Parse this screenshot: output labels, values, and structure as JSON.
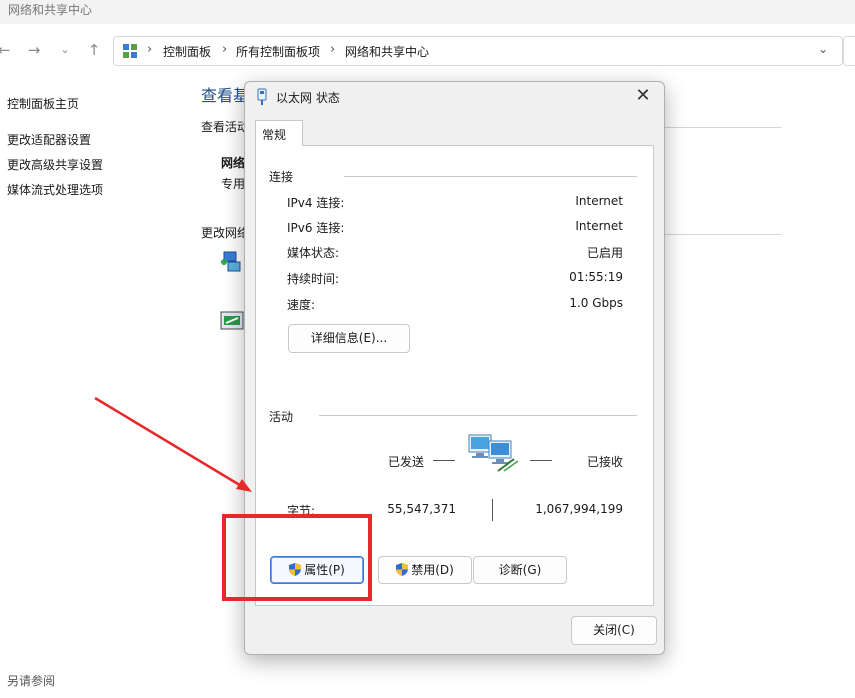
{
  "window": {
    "title": "网络和共享中心"
  },
  "address_bar": {
    "crumbs": [
      "控制面板",
      "所有控制面板项",
      "网络和共享中心"
    ],
    "icon": "control-panel-icon"
  },
  "sidebar": {
    "home": "控制面板主页",
    "items": [
      "更改适配器设置",
      "更改高级共享设置",
      "媒体流式处理选项"
    ],
    "see_also": "另请参阅"
  },
  "main": {
    "title": "查看基",
    "active_networks_label": "查看活动",
    "network_name": "网络",
    "network_type": "专用",
    "change_settings_label": "更改网络"
  },
  "dialog": {
    "title": "以太网 状态",
    "tab_label": "常规",
    "connection": {
      "label": "连接",
      "rows": [
        {
          "label": "IPv4 连接:",
          "value": "Internet"
        },
        {
          "label": "IPv6 连接:",
          "value": "Internet"
        },
        {
          "label": "媒体状态:",
          "value": "已启用"
        },
        {
          "label": "持续时间:",
          "value": "01:55:19"
        },
        {
          "label": "速度:",
          "value": "1.0 Gbps"
        }
      ],
      "details_button": "详细信息(E)..."
    },
    "activity": {
      "label": "活动",
      "sent_label": "已发送",
      "received_label": "已接收",
      "bytes_label": "字节:",
      "bytes_sent": "55,547,371",
      "bytes_received": "1,067,994,199"
    },
    "buttons": {
      "properties": "属性(P)",
      "disable": "禁用(D)",
      "diagnose": "诊断(G)",
      "close": "关闭(C)"
    }
  },
  "colors": {
    "accent": "#1e4e8c",
    "annotation": "#e8282b",
    "focus_border": "#3c7ad8"
  }
}
